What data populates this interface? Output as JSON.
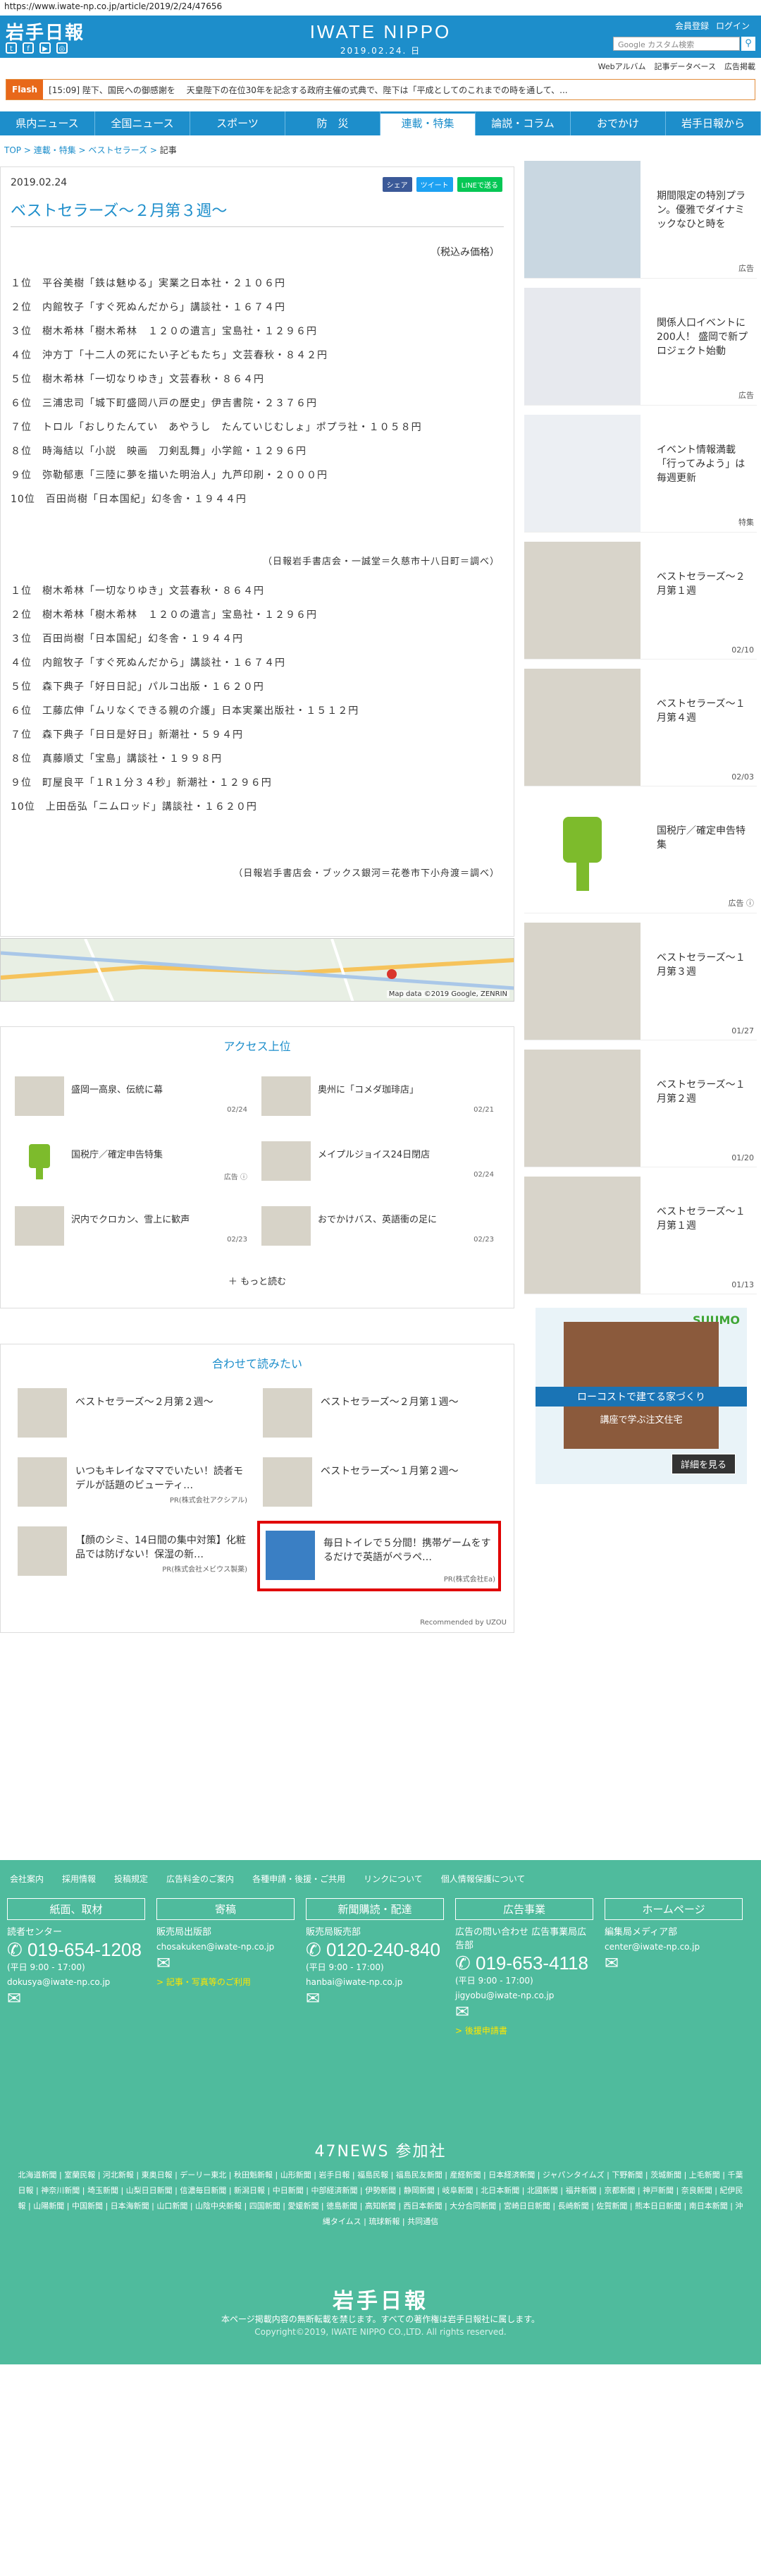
{
  "url": "https://www.iwate-np.co.jp/article/2019/2/24/47656",
  "header": {
    "logo": "岩手日報",
    "brand": "IWATE NIPPO",
    "date": "2019.02.24. 日",
    "links": [
      "会員登録",
      "ログイン"
    ],
    "search_placeholder": "Google カスタム検索",
    "subnav": [
      "Webアルバム",
      "記事データベース",
      "広告掲載"
    ]
  },
  "flash": {
    "tag": "Flash",
    "text": "[15:09] 陛下、国民への御感謝を 　天皇陛下の在位30年を記念する政府主催の式典で、陛下は「平成としてのこれまでの時を通して、..."
  },
  "gnav": [
    "県内ニュース",
    "全国ニュース",
    "スポーツ",
    "防　災",
    "連載・特集",
    "論説・コラム",
    "おでかけ",
    "岩手日報から"
  ],
  "breadcrumb": {
    "items": [
      "TOP",
      "連載・特集",
      "ベストセラーズ"
    ],
    "current": "記事"
  },
  "article": {
    "date": "2019.02.24",
    "share": [
      "シェア",
      "ツイート",
      "LINEで送る"
    ],
    "title": "ベストセラーズ～２月第３週～",
    "tax_note": "（税込み価格）",
    "list1": [
      "１位　平谷美樹「鉄は魅ゆる」実業之日本社・２１０６円",
      "２位　内館牧子「すぐ死ぬんだから」講談社・１６７４円",
      "３位　樹木希林「樹木希林　１２０の遺言」宝島社・１２９６円",
      "４位　沖方丁「十二人の死にたい子どもたち」文芸春秋・８４２円",
      "５位　樹木希林「一切なりゆき」文芸春秋・８６４円",
      "６位　三浦忠司「城下町盛岡八戸の歴史」伊吉書院・２３７６円",
      "７位　トロル「おしりたんてい　あやうし　たんていじむしょ」ポプラ社・１０５８円",
      "８位　時海結以「小説　映画　刀剣乱舞」小学館・１２９６円",
      "９位　弥勒郁恵「三陸に夢を描いた明治人」九芦印刷・２０００円",
      "10位　百田尚樹「日本国紀」幻冬舎・１９４４円"
    ],
    "src1": "（日報岩手書店会・一誠堂＝久慈市十八日町＝調べ）",
    "list2": [
      "１位　樹木希林「一切なりゆき」文芸春秋・８６４円",
      "２位　樹木希林「樹木希林　１２０の遺言」宝島社・１２９６円",
      "３位　百田尚樹「日本国紀」幻冬舎・１９４４円",
      "４位　内館牧子「すぐ死ぬんだから」講談社・１６７４円",
      "５位　森下典子「好日日記」パルコ出版・１６２０円",
      "６位　工藤広伸「ムリなくできる親の介護」日本実業出版社・１５１２円",
      "７位　森下典子「日日是好日」新潮社・５９４円",
      "８位　真藤順丈「宝島」講談社・１９９８円",
      "９位　町屋良平「１R１分３４秒」新潮社・１２９６円",
      "10位　上田岳弘「ニムロッド」講談社・１６２０円"
    ],
    "src2": "（日報岩手書店会・ブックス銀河＝花巻市下小舟渡＝調べ）",
    "map_credit": "Map data ©2019 Google, ZENRIN"
  },
  "access": {
    "title": "アクセス上位",
    "items": [
      {
        "text": "盛岡一高泉、伝統に幕",
        "date": "02/24"
      },
      {
        "text": "奥州に「コメダ珈琲店」",
        "date": "02/21"
      },
      {
        "text": "国税庁／確定申告特集",
        "date": "広告 ⓘ"
      },
      {
        "text": "メイプルジョイス24日閉店",
        "date": "02/24"
      },
      {
        "text": "沢内でクロカン、雪上に歓声",
        "date": "02/23"
      },
      {
        "text": "おでかけバス、英語衝の足に",
        "date": "02/23"
      }
    ],
    "more": "もっと読む"
  },
  "recommend": {
    "title": "合わせて読みたい",
    "items": [
      {
        "text": "ベストセラーズ～２月第２週～",
        "pr": ""
      },
      {
        "text": "ベストセラーズ～２月第１週～",
        "pr": ""
      },
      {
        "text": "いつもキレイなママでいたい！読者モデルが話題のビューティ…",
        "pr": "PR(株式会社アクシアル)"
      },
      {
        "text": "ベストセラーズ～１月第２週～",
        "pr": ""
      },
      {
        "text": "【顔のシミ、14日間の集中対策】化粧品では防げない！保湿の新…",
        "pr": "PR(株式会社メビウス製薬)"
      },
      {
        "text": "毎日トイレで５分間！携帯ゲームをするだけで英語がペラペ…",
        "pr": "PR(株式会社Ea)"
      }
    ],
    "by": "Recommended by UZOU"
  },
  "sidebar": [
    {
      "text": "期間限定の特別プラン。優雅でダイナミックなひと時を",
      "meta": "広告"
    },
    {
      "text": "関係人口イベントに200人！ 盛岡で新プロジェクト始動",
      "meta": "広告"
    },
    {
      "text": "イベント情報満載「行ってみよう」は毎週更新",
      "meta": "特集"
    },
    {
      "text": "ベストセラーズ～２月第１週",
      "meta": "02/10"
    },
    {
      "text": "ベストセラーズ～１月第４週",
      "meta": "02/03"
    },
    {
      "text": "国税庁／確定申告特集",
      "meta": "広告 ⓘ"
    },
    {
      "text": "ベストセラーズ～１月第３週",
      "meta": "01/27"
    },
    {
      "text": "ベストセラーズ～１月第２週",
      "meta": "01/20"
    },
    {
      "text": "ベストセラーズ～１月第１週",
      "meta": "01/13"
    }
  ],
  "side_ad": {
    "brand": "SUUMO",
    "headline": "ローコストで建てる家づくり",
    "sub": "講座で学ぶ注文住宅",
    "button": "詳細を見る"
  },
  "footer": {
    "links": [
      "会社案内",
      "採用情報",
      "投稿規定",
      "広告料金のご案内",
      "各種申請・後援・ご共用",
      "リンクについて",
      "個人情報保護について"
    ],
    "cols": [
      {
        "head": "紙面、取材",
        "sub": "読者センター",
        "tel": "019-654-1208",
        "hour": "(平日 9:00 - 17:00)",
        "mail": "dokusya@iwate-np.co.jp",
        "link": ""
      },
      {
        "head": "寄稿",
        "sub": "販売局出版部",
        "tel": "",
        "hour": "",
        "mail": "chosakuken@iwate-np.co.jp",
        "link": "> 記事・写真等のご利用"
      },
      {
        "head": "新聞購読・配達",
        "sub": "販売局販売部",
        "tel": "0120-240-840",
        "hour": "(平日 9:00 - 17:00)",
        "mail": "hanbai@iwate-np.co.jp",
        "link": ""
      },
      {
        "head": "広告事業",
        "sub": "広告の問い合わせ 広告事業局広告部",
        "tel": "019-653-4118",
        "hour": "(平日 9:00 - 17:00)",
        "mail": "jigyobu@iwate-np.co.jp",
        "link": "> 後援申請書"
      },
      {
        "head": "ホームページ",
        "sub": "編集局メディア部",
        "tel": "",
        "hour": "",
        "mail": "center@iwate-np.co.jp",
        "link": ""
      }
    ],
    "news47": "47NEWS 参加社",
    "news_list": "北海道新聞 | 室蘭民報 | 河北新報 | 東奥日報 | デーリー東北 | 秋田魁新報 | 山形新聞 | 岩手日報 | 福島民報 | 福島民友新聞 | 産経新聞 | 日本経済新聞 | ジャパンタイムズ | 下野新聞 | 茨城新聞 | 上毛新聞 | 千葉日報 | 神奈川新聞 | 埼玉新聞 | 山梨日日新聞 | 信濃毎日新聞 | 新潟日報 | 中日新聞 | 中部経済新聞 | 伊勢新聞 | 静岡新聞 | 岐阜新聞 | 北日本新聞 | 北國新聞 | 福井新聞 | 京都新聞 | 神戸新聞 | 奈良新聞 | 紀伊民報 | 山陽新聞 | 中国新聞 | 日本海新聞 | 山口新聞 | 山陰中央新報 | 四国新聞 | 愛媛新聞 | 徳島新聞 | 高知新聞 | 西日本新聞 | 大分合同新聞 | 宮崎日日新聞 | 長崎新聞 | 佐賀新聞 | 熊本日日新聞 | 南日本新聞 | 沖縄タイムス | 琉球新報 | 共同通信",
    "logo": "岩手日報",
    "copy1": "本ページ掲載内容の無断転載を禁じます。すべての著作権は岩手日報社に属します。",
    "copy2": "Copyright©2019, IWATE NIPPO CO.,LTD. All rights reserved."
  }
}
